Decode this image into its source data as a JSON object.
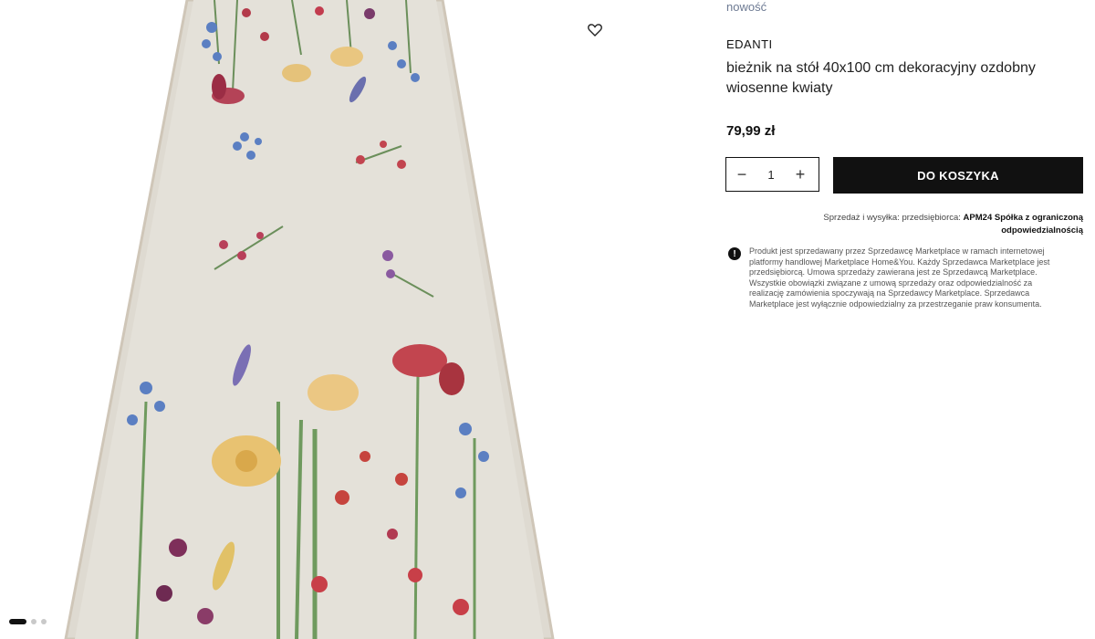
{
  "product": {
    "badge": "nowość",
    "brand": "EDANTI",
    "title": "bieżnik na stół 40x100 cm dekoracyjny ozdobny wiosenne kwiaty",
    "price": "79,99 zł"
  },
  "gallery": {
    "image_icon": "floral-table-runner-image",
    "wishlist_icon": "heart-icon",
    "slide_count": 3,
    "active_slide": 1
  },
  "purchase": {
    "quantity": "1",
    "decrement_label": "−",
    "increment_label": "+",
    "add_to_cart_label": "DO KOSZYKA",
    "button_color": "#111111"
  },
  "seller": {
    "prefix": "Sprzedaż i wysyłka: przedsiębiorca:",
    "name": "APM24 Spółka z ograniczoną odpowiedzialnością"
  },
  "notice": {
    "icon": "exclamation-icon",
    "text": "Produkt jest sprzedawany przez Sprzedawcę Marketplace w ramach internetowej platformy handlowej Marketplace Home&You. Każdy Sprzedawca Marketplace jest przedsiębiorcą. Umowa sprzedaży zawierana jest ze Sprzedawcą Marketplace. Wszystkie obowiązki związane z umową sprzedaży oraz odpowiedzialność za realizację zamówienia spoczywają na Sprzedawcy Marketplace. Sprzedawca Marketplace jest wyłącznie odpowiedzialny za przestrzeganie praw konsumenta."
  }
}
